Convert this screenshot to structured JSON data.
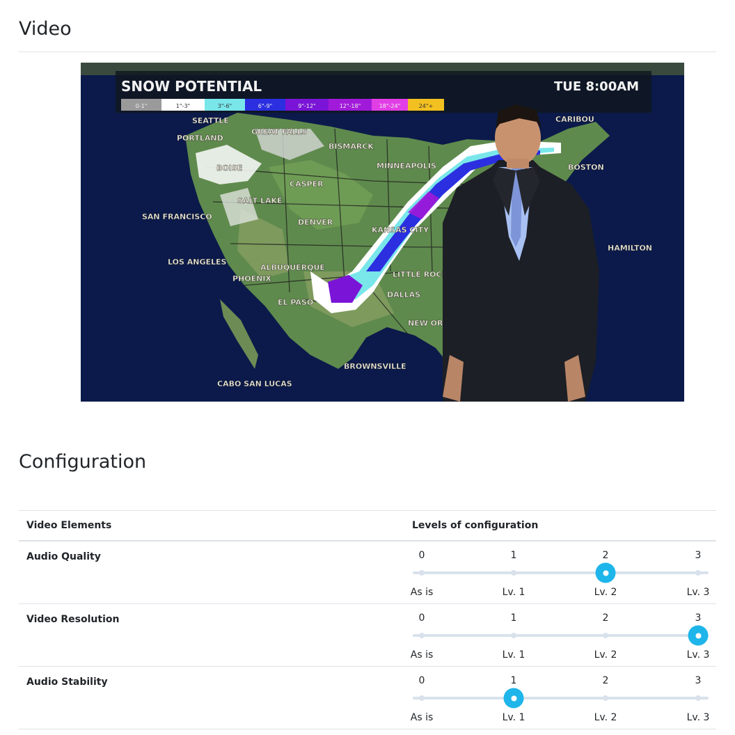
{
  "video_section": {
    "heading": "Video",
    "overlay": {
      "title": "SNOW POTENTIAL",
      "time": "TUE  8:00AM",
      "legend": [
        "0-1\"",
        "1\"-3\"",
        "3\"-6\"",
        "6\"-9\"",
        "9\"-12\"",
        "12\"-18\"",
        "18\"-24\"",
        "24\"+"
      ],
      "legend_colors": [
        "#9a9a9a",
        "#ffffff",
        "#79e6ea",
        "#2b2fe0",
        "#7a14d6",
        "#a11ad9",
        "#e23ee6",
        "#f2c021"
      ],
      "cities": [
        "SEATTLE",
        "PORTLAND",
        "GREAT FALLS",
        "BISMARCK",
        "MINNEAPOLIS",
        "CARIBOU",
        "BOSTON",
        "BOISE",
        "CASPER",
        "SALT LAKE",
        "SAN FRANCISCO",
        "DENVER",
        "KANSAS CITY",
        "HAMILTON",
        "LOS ANGELES",
        "ALBUQUERQUE",
        "PHOENIX",
        "LITTLE ROCK",
        "EL PASO",
        "DALLAS",
        "NEW ORLEANS",
        "BROWNSVILLE",
        "CABO SAN LUCAS"
      ]
    }
  },
  "config_section": {
    "heading": "Configuration",
    "table": {
      "col_element": "Video Elements",
      "col_levels": "Levels of configuration",
      "rows": [
        {
          "label": "Audio Quality",
          "value": 2
        },
        {
          "label": "Video Resolution",
          "value": 3
        },
        {
          "label": "Audio Stability",
          "value": 1
        }
      ],
      "scale_numbers": [
        "0",
        "1",
        "2",
        "3"
      ],
      "scale_labels": [
        "As is",
        "Lv. 1",
        "Lv. 2",
        "Lv. 3"
      ]
    }
  },
  "colors": {
    "accent": "#1eb5ea",
    "track": "#d9e2ec"
  }
}
